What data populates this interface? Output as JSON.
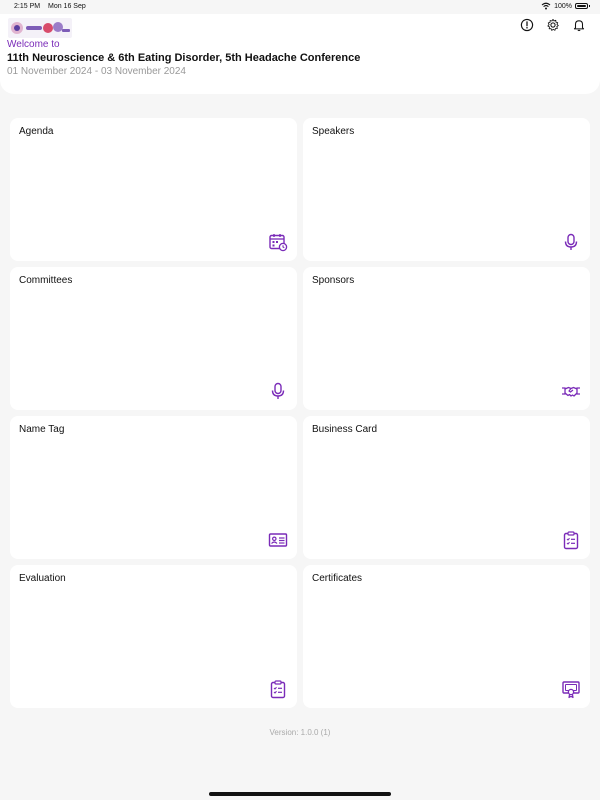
{
  "status_bar": {
    "time": "2:15 PM",
    "date": "Mon 16 Sep",
    "battery": "100%"
  },
  "header": {
    "welcome": "Welcome to",
    "title": "11th Neuroscience & 6th Eating Disorder, 5th Headache Conference",
    "dates": "01 November 2024 - 03 November 2024",
    "icons": [
      "alert-icon",
      "gear-icon",
      "bell-icon"
    ]
  },
  "cards": [
    {
      "label": "Agenda",
      "icon": "calendar-icon"
    },
    {
      "label": "Speakers",
      "icon": "microphone-icon"
    },
    {
      "label": "Committees",
      "icon": "microphone-icon"
    },
    {
      "label": "Sponsors",
      "icon": "handshake-icon"
    },
    {
      "label": "Name Tag",
      "icon": "id-card-icon"
    },
    {
      "label": "Business Card",
      "icon": "clipboard-icon"
    },
    {
      "label": "Evaluation",
      "icon": "clipboard-icon"
    },
    {
      "label": "Certificates",
      "icon": "certificate-icon"
    }
  ],
  "footer": {
    "version": "Version: 1.0.0 (1)"
  },
  "colors": {
    "accent": "#7a2bb8",
    "background": "#f6f6f6",
    "card": "#ffffff"
  }
}
